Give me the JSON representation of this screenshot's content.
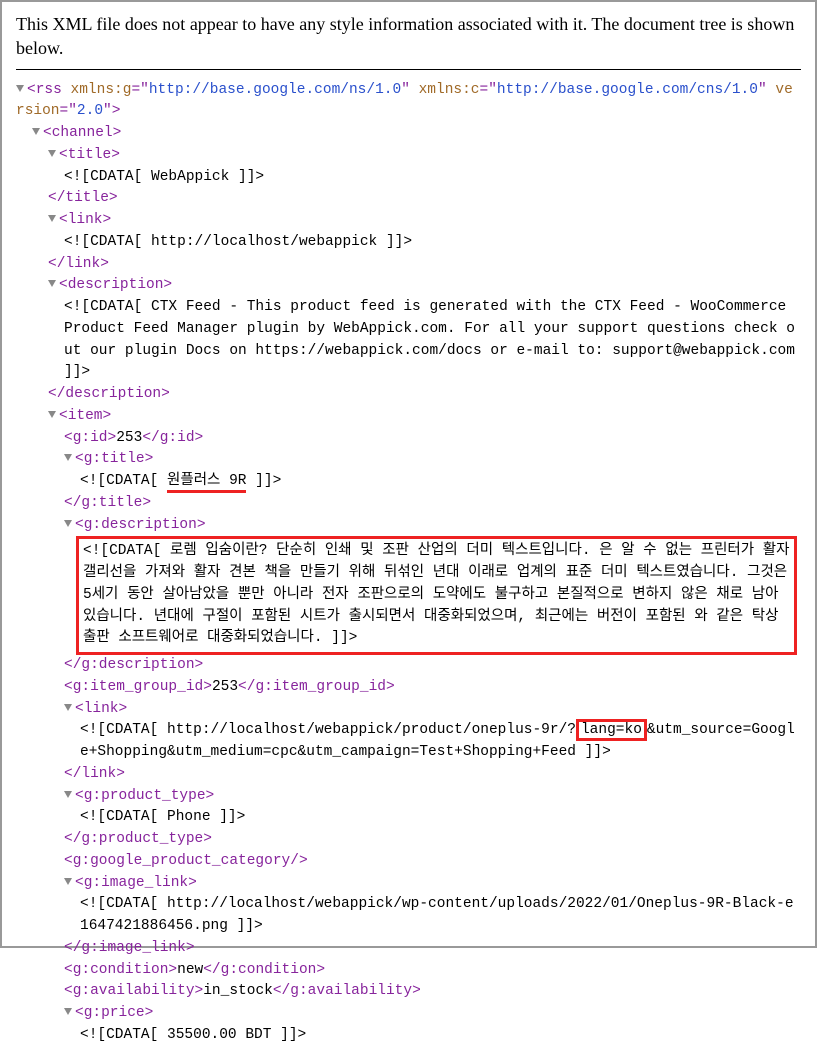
{
  "notice": "This XML file does not appear to have any style information associated with it. The document tree is shown below.",
  "rss": {
    "attrs": {
      "xmlns_g_name": "xmlns:g",
      "xmlns_g_val": "http://base.google.com/ns/1.0",
      "xmlns_c_name": "xmlns:c",
      "xmlns_c_val": "http://base.google.com/cns/1.0",
      "version_name": "version",
      "version_val": "2.0"
    }
  },
  "channel": {
    "title_cdata": "<![CDATA[ WebAppick ]]>",
    "link_cdata": "<![CDATA[ http://localhost/webappick ]]>",
    "description_cdata": "<![CDATA[ CTX Feed - This product feed is generated with the CTX Feed - WooCommerce Product Feed Manager plugin by WebAppick.com. For all your support questions check out our plugin Docs on https://webappick.com/docs or e-mail to: support@webappick.com ]]>"
  },
  "item": {
    "g_id": "253",
    "g_title_prefix": "<![CDATA[ ",
    "g_title_main": "원플러스 9R",
    "g_title_suffix": " ]]>",
    "g_description_cdata": "<![CDATA[ 로렘 입숨이란? 단순히 인쇄 및 조판 산업의 더미 텍스트입니다. 은 알 수 없는 프린터가 활자 갤리선을 가져와 활자 견본 책을 만들기 위해 뒤섞인 년대 이래로 업계의 표준 더미 텍스트였습니다. 그것은 5세기 동안 살아남았을 뿐만 아니라 전자 조판으로의 도약에도 불구하고 본질적으로 변하지 않은 채로 남아 있습니다. 년대에 구절이 포함된 시트가 출시되면서 대중화되었으며, 최근에는 버전이 포함된 와 같은 탁상 출판 소프트웨어로 대중화되었습니다. ]]>",
    "g_item_group_id": "253",
    "link_prefix": "<![CDATA[ http://localhost/webappick/product/oneplus-9r/?",
    "link_highlight": "lang=ko",
    "link_suffix": "&utm_source=Google+Shopping&utm_medium=cpc&utm_campaign=Test+Shopping+Feed ]]>",
    "g_product_type_cdata": "<![CDATA[ Phone ]]>",
    "g_image_link_cdata": "<![CDATA[ http://localhost/webappick/wp-content/uploads/2022/01/Oneplus-9R-Black-e1647421886456.png ]]>",
    "g_condition": "new",
    "g_availability": "in_stock",
    "g_price_cdata": "<![CDATA[ 35500.00 BDT ]]>"
  },
  "tags": {
    "rss": "rss",
    "channel": "channel",
    "title": "title",
    "link": "link",
    "description": "description",
    "item": "item",
    "g_id": "g:id",
    "g_title": "g:title",
    "g_description": "g:description",
    "g_item_group_id": "g:item_group_id",
    "g_product_type": "g:product_type",
    "g_google_product_category": "g:google_product_category",
    "g_image_link": "g:image_link",
    "g_condition": "g:condition",
    "g_availability": "g:availability",
    "g_price": "g:price"
  }
}
